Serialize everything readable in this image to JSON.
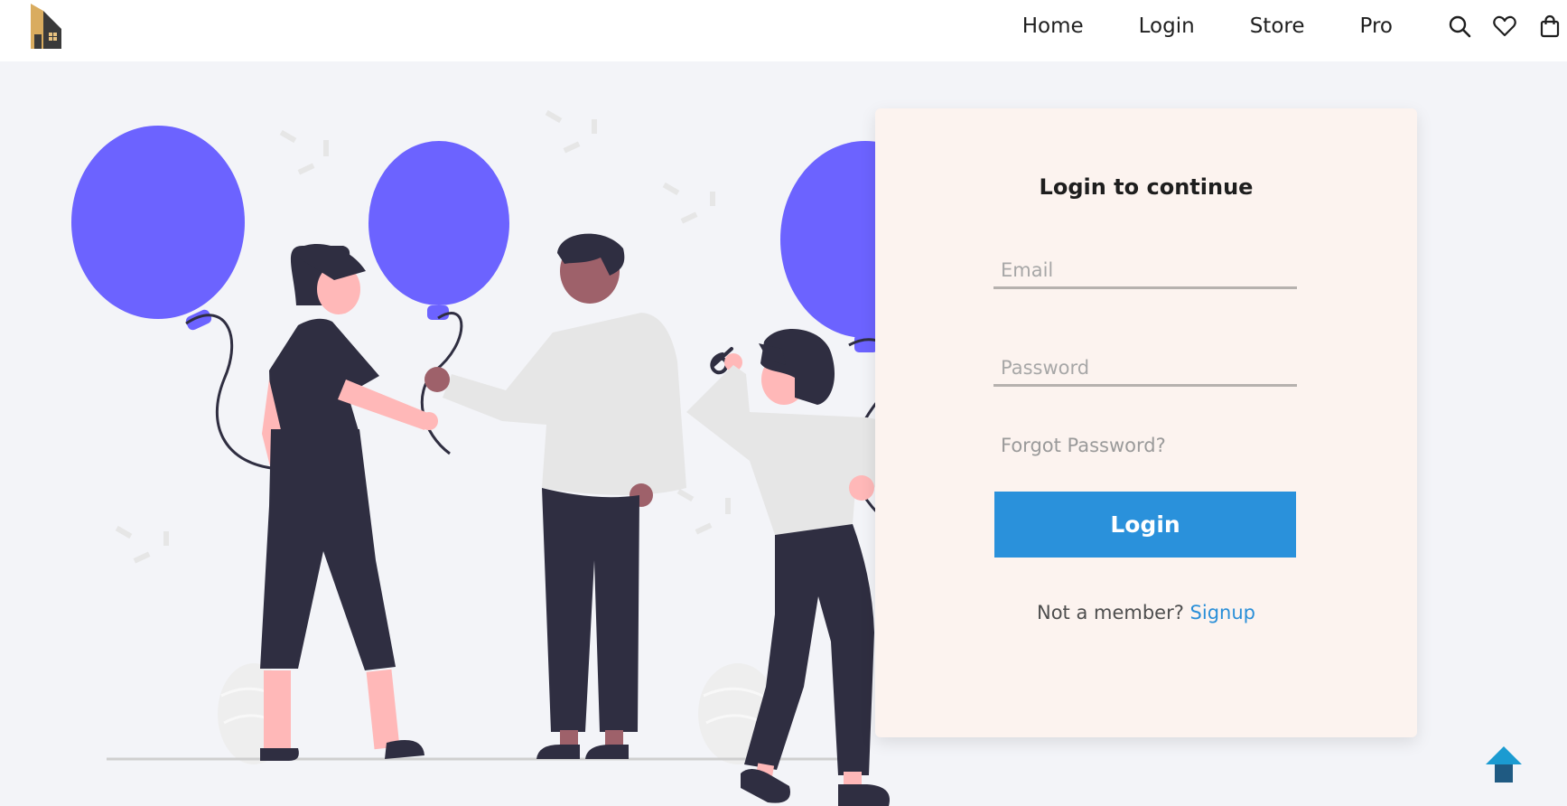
{
  "nav": {
    "links": [
      "Home",
      "Login",
      "Store",
      "Pro"
    ],
    "icons": [
      "search-icon",
      "heart-icon",
      "shopping-bag-icon"
    ]
  },
  "login_form": {
    "title": "Login to continue",
    "email_placeholder": "Email",
    "password_placeholder": "Password",
    "forgot_password": "Forgot Password?",
    "submit_label": "Login",
    "signup_prompt": "Not a member?",
    "signup_link": "Signup"
  },
  "colors": {
    "accent": "#2a91db",
    "balloon": "#6c63ff",
    "card_background": "#fcf3ef",
    "page_background": "#f3f4f8",
    "figure_dark": "#2f2e41",
    "figure_light": "#e6e6e6",
    "skin_light": "#ffb8b8",
    "skin_dark": "#9e616a",
    "scroll_top_button": "#1b9bd1"
  }
}
